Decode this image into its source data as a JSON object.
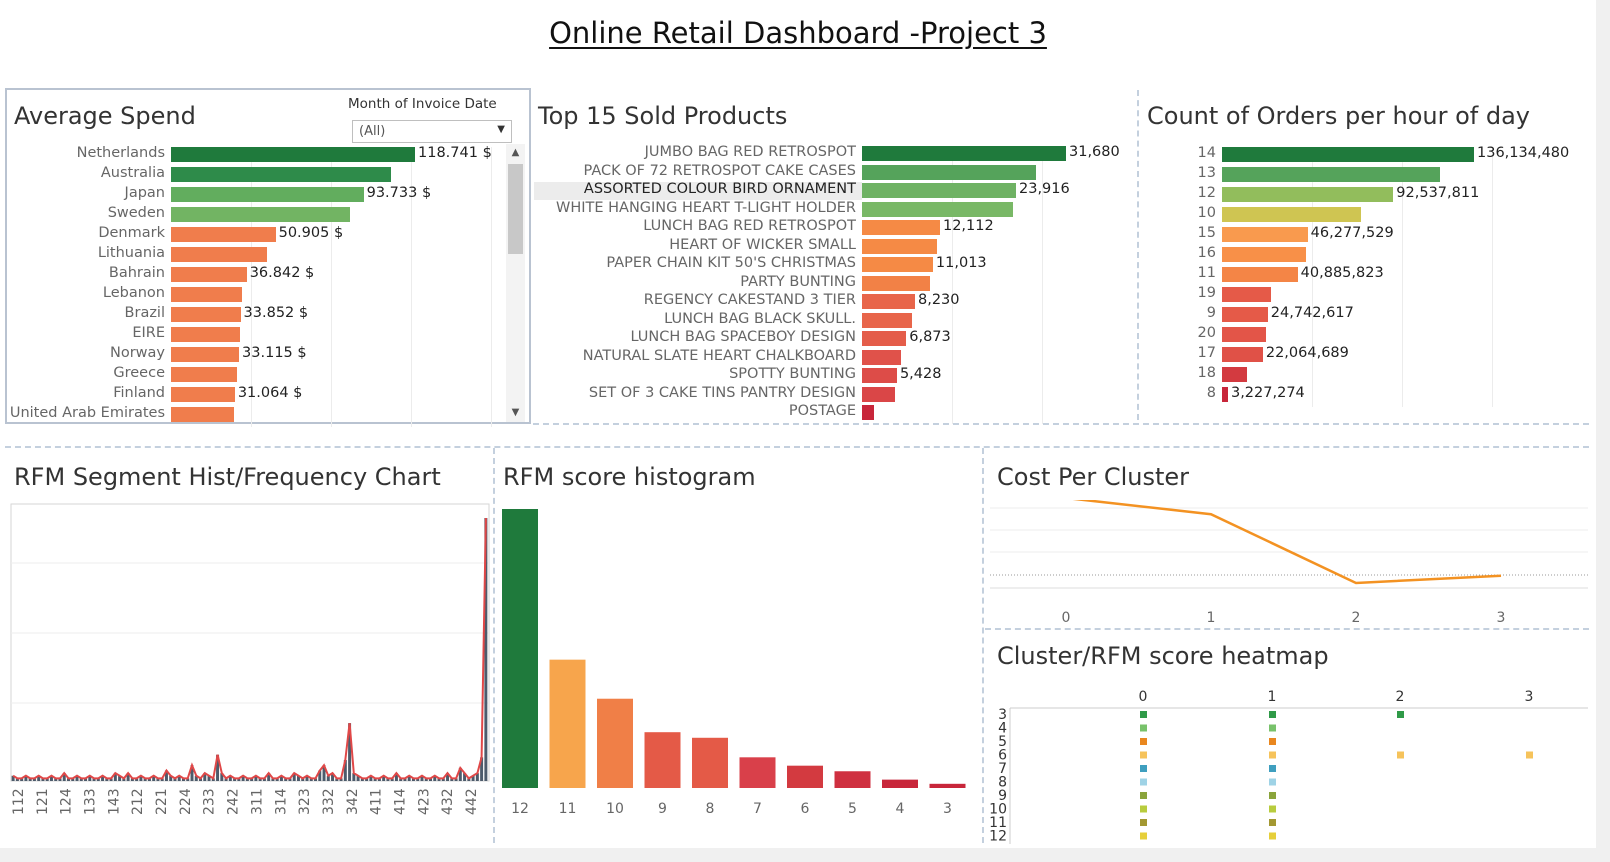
{
  "title": "Online Retail Dashboard -Project 3",
  "avg_spend": {
    "title": "Average Spend",
    "filter_label": "Month of Invoice Date",
    "filter_value": "(All)",
    "rows": [
      {
        "label": "Netherlands",
        "value": 118741,
        "text": "118.741 $",
        "color": "#1f7a3c"
      },
      {
        "label": "Australia",
        "value": 107000,
        "text": "",
        "color": "#2e8b4a"
      },
      {
        "label": "Japan",
        "value": 93733,
        "text": "93.733 $",
        "color": "#62ad5e"
      },
      {
        "label": "Sweden",
        "value": 87000,
        "text": "",
        "color": "#72b463"
      },
      {
        "label": "Denmark",
        "value": 50905,
        "text": "50.905 $",
        "color": "#f07d4c"
      },
      {
        "label": "Lithuania",
        "value": 46500,
        "text": "",
        "color": "#f07d4c"
      },
      {
        "label": "Bahrain",
        "value": 36842,
        "text": "36.842 $",
        "color": "#f07d4c"
      },
      {
        "label": "Lebanon",
        "value": 34700,
        "text": "",
        "color": "#f07d4c"
      },
      {
        "label": "Brazil",
        "value": 33852,
        "text": "33.852 $",
        "color": "#f07d4c"
      },
      {
        "label": "EIRE",
        "value": 33500,
        "text": "",
        "color": "#f07d4c"
      },
      {
        "label": "Norway",
        "value": 33115,
        "text": "33.115 $",
        "color": "#f07d4c"
      },
      {
        "label": "Greece",
        "value": 32000,
        "text": "",
        "color": "#f07d4c"
      },
      {
        "label": "Finland",
        "value": 31064,
        "text": "31.064 $",
        "color": "#f07d4c"
      },
      {
        "label": "United Arab Emirates",
        "value": 30500,
        "text": "",
        "color": "#f07d4c"
      }
    ]
  },
  "top_products": {
    "title": "Top 15 Sold Products",
    "rows": [
      {
        "label": "JUMBO BAG RED RETROSPOT",
        "value": 31680,
        "text": "31,680",
        "color": "#1f7a3c"
      },
      {
        "label": "PACK OF 72 RETROSPOT CAKE CASES",
        "value": 27000,
        "text": "",
        "color": "#55a35b"
      },
      {
        "label": "ASSORTED COLOUR BIRD ORNAMENT",
        "value": 23916,
        "text": "23,916",
        "color": "#6fb264"
      },
      {
        "label": "WHITE HANGING HEART T-LIGHT HOLDER",
        "value": 23500,
        "text": "",
        "color": "#79b866"
      },
      {
        "label": "LUNCH BAG RED RETROSPOT",
        "value": 12112,
        "text": "12,112",
        "color": "#f58a45"
      },
      {
        "label": "HEART OF WICKER SMALL",
        "value": 11600,
        "text": "",
        "color": "#f58a45"
      },
      {
        "label": "PAPER CHAIN KIT 50'S CHRISTMAS",
        "value": 11013,
        "text": "11,013",
        "color": "#f58a45"
      },
      {
        "label": "PARTY BUNTING",
        "value": 10600,
        "text": "",
        "color": "#f28146"
      },
      {
        "label": "REGENCY CAKESTAND 3 TIER",
        "value": 8230,
        "text": "8,230",
        "color": "#e8654a"
      },
      {
        "label": "LUNCH BAG  BLACK SKULL.",
        "value": 7800,
        "text": "",
        "color": "#e8654a"
      },
      {
        "label": "LUNCH BAG SPACEBOY DESIGN",
        "value": 6873,
        "text": "6,873",
        "color": "#e45d4a"
      },
      {
        "label": "NATURAL SLATE HEART CHALKBOARD",
        "value": 6100,
        "text": "",
        "color": "#e0524a"
      },
      {
        "label": "SPOTTY BUNTING",
        "value": 5428,
        "text": "5,428",
        "color": "#dd4c48"
      },
      {
        "label": "SET OF 3 CAKE TINS PANTRY DESIGN",
        "value": 5200,
        "text": "",
        "color": "#da4647"
      },
      {
        "label": "POSTAGE",
        "value": 1800,
        "text": "",
        "color": "#c8263a"
      }
    ]
  },
  "orders_hour": {
    "title": "Count of Orders per hour of day",
    "rows": [
      {
        "label": "14",
        "value": 136134480,
        "text": "136,134,480",
        "color": "#1f7a3c"
      },
      {
        "label": "13",
        "value": 118000000,
        "text": "",
        "color": "#55a35b"
      },
      {
        "label": "12",
        "value": 92537811,
        "text": "92,537,811",
        "color": "#92bd5c"
      },
      {
        "label": "10",
        "value": 75000000,
        "text": "",
        "color": "#cfc552"
      },
      {
        "label": "15",
        "value": 46277529,
        "text": "46,277,529",
        "color": "#f99a4e"
      },
      {
        "label": "16",
        "value": 45500000,
        "text": "",
        "color": "#f89048"
      },
      {
        "label": "11",
        "value": 40885823,
        "text": "40,885,823",
        "color": "#f48546"
      },
      {
        "label": "19",
        "value": 26500000,
        "text": "",
        "color": "#e55a48"
      },
      {
        "label": "9",
        "value": 24742617,
        "text": "24,742,617",
        "color": "#e55a48"
      },
      {
        "label": "20",
        "value": 24000000,
        "text": "",
        "color": "#e35548"
      },
      {
        "label": "17",
        "value": 22064689,
        "text": "22,064,689",
        "color": "#e05147"
      },
      {
        "label": "18",
        "value": 13500000,
        "text": "",
        "color": "#d33a40"
      },
      {
        "label": "8",
        "value": 3227274,
        "text": "3,227,274",
        "color": "#c8263a"
      }
    ]
  },
  "rfm_segment": {
    "title": "RFM Segment Hist/Frequency Chart",
    "ticks": [
      "112",
      "121",
      "124",
      "133",
      "143",
      "212",
      "221",
      "224",
      "233",
      "242",
      "311",
      "314",
      "323",
      "332",
      "342",
      "411",
      "414",
      "423",
      "432",
      "442"
    ],
    "bar_color": "#4d5b6b",
    "line_color": "#e04848",
    "values": [
      2,
      1,
      1,
      2,
      1,
      1,
      2,
      1,
      1,
      2,
      1,
      1,
      3,
      1,
      1,
      2,
      1,
      1,
      2,
      1,
      1,
      2,
      1,
      1,
      3,
      2,
      1,
      3,
      1,
      1,
      2,
      1,
      1,
      2,
      1,
      1,
      4,
      2,
      1,
      2,
      1,
      1,
      6,
      2,
      1,
      3,
      2,
      1,
      10,
      3,
      1,
      2,
      1,
      1,
      2,
      1,
      1,
      2,
      1,
      1,
      3,
      1,
      1,
      2,
      1,
      1,
      3,
      2,
      1,
      2,
      1,
      1,
      4,
      6,
      2,
      3,
      1,
      1,
      8,
      22,
      3,
      2,
      1,
      1,
      2,
      1,
      1,
      2,
      1,
      1,
      3,
      1,
      1,
      2,
      1,
      1,
      2,
      1,
      1,
      2,
      1,
      1,
      3,
      1,
      1,
      5,
      3,
      1,
      2,
      3,
      9,
      100
    ]
  },
  "rfm_hist": {
    "title": "RFM score histogram",
    "categories": [
      "12",
      "11",
      "10",
      "9",
      "8",
      "7",
      "6",
      "5",
      "4",
      "3"
    ],
    "values": [
      100,
      46,
      32,
      20,
      18,
      11,
      8,
      6,
      3,
      1.5
    ],
    "colors": [
      "#1f7a3c",
      "#f7a54c",
      "#f07f47",
      "#e45a47",
      "#e45a47",
      "#d9404a",
      "#d33a40",
      "#cf3040",
      "#c8263a",
      "#c8263a"
    ]
  },
  "cost_cluster": {
    "title": "Cost Per Cluster",
    "categories": [
      "0",
      "1",
      "2",
      "3"
    ],
    "values": [
      100,
      80,
      -5,
      4
    ],
    "line_color": "#f39222"
  },
  "heatmap": {
    "title": "Cluster/RFM score heatmap",
    "columns": [
      "0",
      "1",
      "2",
      "3"
    ],
    "rows": [
      "3",
      "4",
      "5",
      "6",
      "7",
      "8",
      "9",
      "10",
      "11",
      "12"
    ],
    "row_colors": [
      "#2f9a48",
      "#78c26b",
      "#e9871f",
      "#f6c35b",
      "#3f9fbf",
      "#9fd3e6",
      "#8aa43b",
      "#b8cc3e",
      "#a39832",
      "#e6cf3a"
    ],
    "presence": [
      [
        1,
        1,
        1,
        0
      ],
      [
        1,
        1,
        0,
        0
      ],
      [
        1,
        1,
        0,
        0
      ],
      [
        1,
        1,
        1,
        1
      ],
      [
        1,
        1,
        0,
        0
      ],
      [
        1,
        1,
        0,
        0
      ],
      [
        1,
        1,
        0,
        0
      ],
      [
        1,
        1,
        0,
        0
      ],
      [
        1,
        1,
        0,
        0
      ],
      [
        1,
        1,
        0,
        0
      ]
    ]
  }
}
